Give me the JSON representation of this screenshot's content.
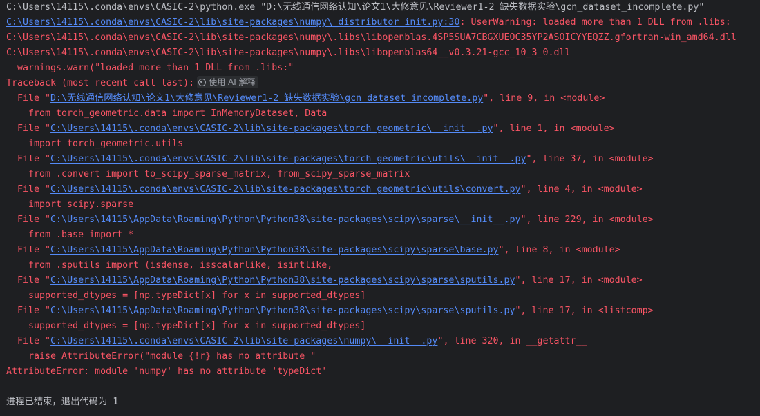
{
  "console": {
    "cmd_line": "C:\\Users\\14115\\.conda\\envs\\CASIC-2\\python.exe \"D:\\无线通信网络认知\\论文1\\大修意见\\Reviewer1-2 缺失数据实验\\gcn_dataset_incomplete.py\"",
    "warn_link": "C:\\Users\\14115\\.conda\\envs\\CASIC-2\\lib\\site-packages\\numpy\\_distributor_init.py:30",
    "warn_msg": ": UserWarning: loaded more than 1 DLL from .libs:",
    "dll_1": "C:\\Users\\14115\\.conda\\envs\\CASIC-2\\lib\\site-packages\\numpy\\.libs\\libopenblas.4SP5SUA7CBGXUEOC35YP2ASOICYYEQZZ.gfortran-win_amd64.dll",
    "dll_2": "C:\\Users\\14115\\.conda\\envs\\CASIC-2\\lib\\site-packages\\numpy\\.libs\\libopenblas64__v0.3.21-gcc_10_3_0.dll",
    "warn_code": "  warnings.warn(\"loaded more than 1 DLL from .libs:\"",
    "traceback_header": "Traceback (most recent call last):",
    "ai_button": "使用 AI 解释",
    "frames": [
      {
        "path": "D:\\无线通信网络认知\\论文1\\大修意见\\Reviewer1-2 缺失数据实验\\gcn_dataset_incomplete.py",
        "suffix": "\", line 9, in <module>",
        "code": "from torch_geometric.data import InMemoryDataset, Data"
      },
      {
        "path": "C:\\Users\\14115\\.conda\\envs\\CASIC-2\\lib\\site-packages\\torch_geometric\\__init__.py",
        "suffix": "\", line 1, in <module>",
        "code": "import torch_geometric.utils"
      },
      {
        "path": "C:\\Users\\14115\\.conda\\envs\\CASIC-2\\lib\\site-packages\\torch_geometric\\utils\\__init__.py",
        "suffix": "\", line 37, in <module>",
        "code": "from .convert import to_scipy_sparse_matrix, from_scipy_sparse_matrix"
      },
      {
        "path": "C:\\Users\\14115\\.conda\\envs\\CASIC-2\\lib\\site-packages\\torch_geometric\\utils\\convert.py",
        "suffix": "\", line 4, in <module>",
        "code": "import scipy.sparse"
      },
      {
        "path": "C:\\Users\\14115\\AppData\\Roaming\\Python\\Python38\\site-packages\\scipy\\sparse\\__init__.py",
        "suffix": "\", line 229, in <module>",
        "code": "from .base import *"
      },
      {
        "path": "C:\\Users\\14115\\AppData\\Roaming\\Python\\Python38\\site-packages\\scipy\\sparse\\base.py",
        "suffix": "\", line 8, in <module>",
        "code": "from .sputils import (isdense, isscalarlike, isintlike,"
      },
      {
        "path": "C:\\Users\\14115\\AppData\\Roaming\\Python\\Python38\\site-packages\\scipy\\sparse\\sputils.py",
        "suffix": "\", line 17, in <module>",
        "code": "supported_dtypes = [np.typeDict[x] for x in supported_dtypes]"
      },
      {
        "path": "C:\\Users\\14115\\AppData\\Roaming\\Python\\Python38\\site-packages\\scipy\\sparse\\sputils.py",
        "suffix": "\", line 17, in <listcomp>",
        "code": "supported_dtypes = [np.typeDict[x] for x in supported_dtypes]"
      },
      {
        "path": "C:\\Users\\14115\\.conda\\envs\\CASIC-2\\lib\\site-packages\\numpy\\__init__.py",
        "suffix": "\", line 320, in __getattr__",
        "code": "raise AttributeError(\"module {!r} has no attribute \""
      }
    ],
    "file_prefix": "File \"",
    "error_line": "AttributeError: module 'numpy' has no attribute 'typeDict'",
    "exit_line": "进程已结束，退出代码为 1"
  },
  "colors": {
    "background": "#1e1f22",
    "plain_text": "#bcbec4",
    "error_text": "#f75464",
    "link_text": "#548af7"
  },
  "icons": {
    "ai_button_icon": "ai-sparkle-icon"
  }
}
